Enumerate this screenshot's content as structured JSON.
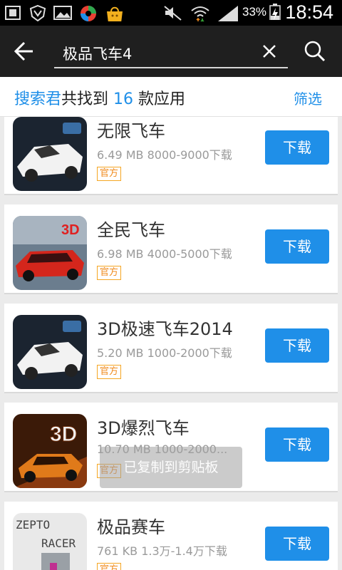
{
  "status_bar": {
    "battery_percent": "33%",
    "time": "18:54"
  },
  "search": {
    "query": "极品飞车4"
  },
  "summary": {
    "prefix": "搜索君",
    "middle": "共找到",
    "count": "16",
    "suffix": "款应用",
    "filter_label": "筛选"
  },
  "results": [
    {
      "name": "无限飞车",
      "size": "6.49 MB",
      "downloads": "8000-9000下载",
      "badge": "官方",
      "button": "下载",
      "icon": "racing-car-white-icon"
    },
    {
      "name": "全民飞车",
      "size": "6.98 MB",
      "downloads": "4000-5000下载",
      "badge": "官方",
      "button": "下载",
      "icon": "racing-car-red-3d-icon"
    },
    {
      "name": "3D极速飞车2014",
      "size": "5.20 MB",
      "downloads": "1000-2000下载",
      "badge": "官方",
      "button": "下载",
      "icon": "racing-car-white-icon"
    },
    {
      "name": "3D爆烈飞车",
      "size": "10.70 MB",
      "downloads": "1000-2000...",
      "badge": "官方",
      "button": "下载",
      "icon": "racing-car-orange-3d-icon"
    },
    {
      "name": "极品赛车",
      "size": "761 KB",
      "downloads": "1.3万-1.4万下载",
      "badge": "官方",
      "button": "下载",
      "icon": "zepto-racer-icon"
    }
  ],
  "toast": "已复制到剪贴板",
  "colors": {
    "accent": "#1f8fe8",
    "badge": "#f08a1c",
    "header": "#1f1f1f"
  }
}
